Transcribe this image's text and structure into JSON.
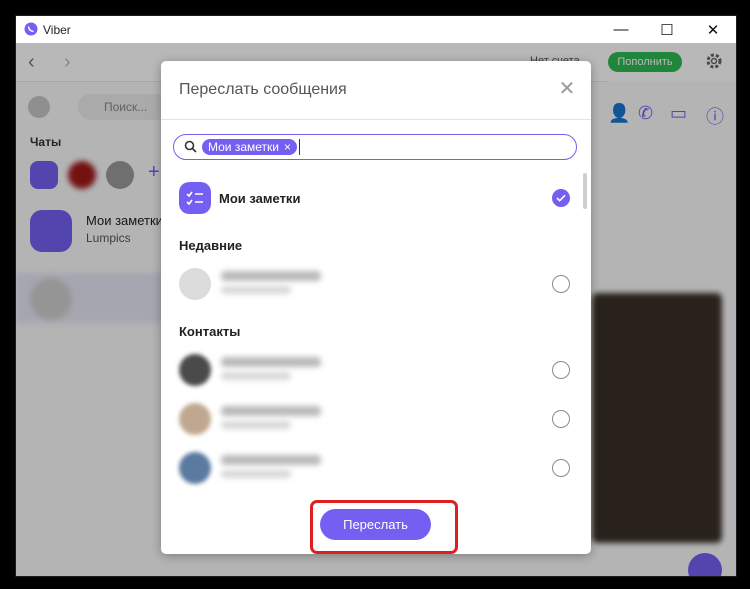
{
  "window": {
    "title": "Viber",
    "controls": {
      "minimize": "—",
      "maximize": "☐",
      "close": "✕"
    }
  },
  "background": {
    "status_text": "Нет счета",
    "topup_label": "Пополнить",
    "search_placeholder": "Поиск...",
    "chats_label": "Чаты",
    "chat": {
      "name": "Мои заметки",
      "subtitle": "Lumpics"
    },
    "colors": {
      "accent": "#7360f2",
      "green": "#2dba52"
    }
  },
  "dialog": {
    "title": "Переслать сообщения",
    "close_icon": "close-icon",
    "search": {
      "chip_label": "Мои заметки",
      "chip_remove": "×"
    },
    "pinned": {
      "name": "Мои заметки",
      "checked": true
    },
    "sections": {
      "recent": "Недавние",
      "contacts": "Контакты"
    },
    "contacts": [
      {
        "checked": false
      },
      {
        "checked": false
      },
      {
        "checked": false
      },
      {
        "checked": false
      }
    ],
    "forward_button": "Переслать"
  }
}
